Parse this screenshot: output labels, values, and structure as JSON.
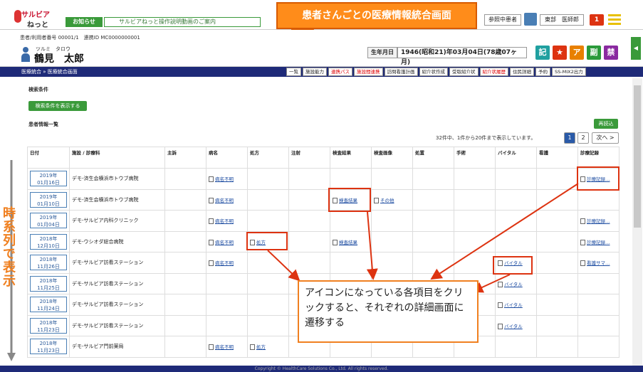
{
  "header": {
    "logo_top": "サルビア",
    "logo_bottom": "ねっと",
    "notice_label": "お知らせ",
    "notice_text": "サルビアねっと操作説明動画のご案内",
    "ref_patient_label": "参照中患者",
    "user_name": "東部　医師郎",
    "notification_count": "1"
  },
  "callouts": {
    "title": "患者さんごとの医療情報統合画面",
    "body": "アイコンになっている各項目をクリックすると、それぞれの詳細画面に遷移する",
    "vertical": "時系列で表示"
  },
  "patient": {
    "id_line": "患者/利用者番号 00001/1　連携ID MC0000000001",
    "kana": "ツルミ　タロウ",
    "name": "鶴見　太郎",
    "dob_label": "生年月日",
    "dob_value": "1946(昭和21)年03月04日(78歳07ヶ月)",
    "pills": [
      {
        "label": "記",
        "color": "#20a0a0"
      },
      {
        "label": "★",
        "color": "#d31"
      },
      {
        "label": "ア",
        "color": "#e88000"
      },
      {
        "label": "副",
        "color": "#2a9a3a"
      },
      {
        "label": "禁",
        "color": "#8a2aa0"
      }
    ]
  },
  "nav": {
    "breadcrumb": "医療統合 » 医療統合画面",
    "buttons": [
      {
        "label": "一覧",
        "red": false
      },
      {
        "label": "施設能力",
        "red": false
      },
      {
        "label": "連携パス",
        "red": true
      },
      {
        "label": "施設間連携",
        "red": true
      },
      {
        "label": "訪問看護計画",
        "red": false
      },
      {
        "label": "紹介状作成",
        "red": false
      },
      {
        "label": "受取紹介状",
        "red": false
      },
      {
        "label": "紹介状履歴",
        "red": true
      },
      {
        "label": "住民詳細",
        "red": false
      },
      {
        "label": "予約",
        "red": false
      },
      {
        "label": "SS-MIX2出力",
        "red": false
      }
    ]
  },
  "search": {
    "title": "検索条件",
    "show_button": "検索条件を表示する"
  },
  "list": {
    "title": "患者情報一覧",
    "reload": "再読込",
    "page_info": "32件中、1件から20件まで表示しています。",
    "pages": [
      "1",
      "2"
    ],
    "next": "次へ >",
    "columns": [
      "日付",
      "施設 / 診療科",
      "主訴",
      "病名",
      "処方",
      "注射",
      "検査結果",
      "検査画像",
      "処置",
      "手術",
      "バイタル",
      "看護",
      "診療記録"
    ],
    "rows": [
      {
        "y": "2019年",
        "d": "01月16日",
        "facility": "デモ-済生会横浜市トウブ病院",
        "disease": "病名不明",
        "rx": "",
        "lab": "",
        "img": "",
        "vital": "",
        "record": "診療記録…"
      },
      {
        "y": "2019年",
        "d": "01月10日",
        "facility": "デモ-済生会横浜市トウブ病院",
        "disease": "病名不明",
        "rx": "",
        "lab": "検査結果",
        "img": "その他",
        "vital": "",
        "record": ""
      },
      {
        "y": "2019年",
        "d": "01月04日",
        "facility": "デモ-サルビア内科クリニック",
        "disease": "病名不明",
        "rx": "",
        "lab": "",
        "img": "",
        "vital": "",
        "record": "診療記録…"
      },
      {
        "y": "2018年",
        "d": "12月10日",
        "facility": "デモ-ウシオダ総合病院",
        "disease": "病名不明",
        "rx": "処方",
        "lab": "検査結果",
        "img": "",
        "vital": "",
        "record": "診療記録…"
      },
      {
        "y": "2018年",
        "d": "11月26日",
        "facility": "デモ-サルビア訪看ステーション",
        "disease": "病名不明",
        "rx": "",
        "lab": "",
        "img": "",
        "vital": "バイタル",
        "record": "看護サマ…"
      },
      {
        "y": "2018年",
        "d": "11月25日",
        "facility": "デモ-サルビア訪看ステーション",
        "disease": "",
        "rx": "",
        "lab": "",
        "img": "",
        "vital": "バイタル",
        "record": ""
      },
      {
        "y": "2018年",
        "d": "11月24日",
        "facility": "デモ-サルビア訪看ステーション",
        "disease": "",
        "rx": "",
        "lab": "",
        "img": "",
        "vital": "バイタル",
        "record": ""
      },
      {
        "y": "2018年",
        "d": "11月23日",
        "facility": "デモ-サルビア訪看ステーション",
        "disease": "",
        "rx": "",
        "lab": "",
        "img": "",
        "vital": "バイタル",
        "record": ""
      },
      {
        "y": "2018年",
        "d": "11月23日",
        "facility": "デモ-サルビア門前薬局",
        "disease": "病名不明",
        "rx": "処方",
        "lab": "",
        "img": "",
        "vital": "",
        "record": ""
      }
    ]
  },
  "footer": "Copyright © HealthCare Solutions Co., Ltd. All rights reserved."
}
